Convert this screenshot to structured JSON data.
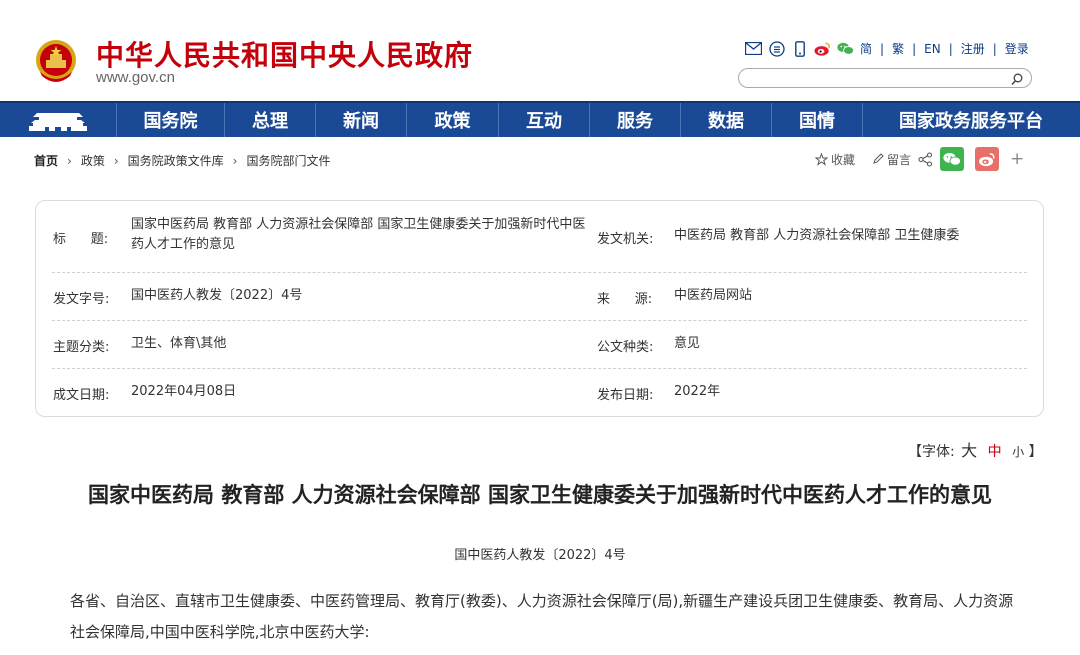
{
  "header": {
    "site_title": "中华人民共和国中央人民政府",
    "site_url": "www.gov.cn",
    "links": [
      "简",
      "繁",
      "EN",
      "注册",
      "登录"
    ],
    "search_placeholder": ""
  },
  "nav": {
    "items": [
      "国务院",
      "总理",
      "新闻",
      "政策",
      "互动",
      "服务",
      "数据",
      "国情",
      "国家政务服务平台"
    ]
  },
  "breadcrumb": {
    "items": [
      "首页",
      "政策",
      "国务院政策文件库",
      "国务院部门文件"
    ]
  },
  "tools": {
    "favorite": "收藏",
    "comment": "留言",
    "plus": "+"
  },
  "info": {
    "rows": [
      {
        "label": "标      题:",
        "value": "国家中医药局 教育部 人力资源社会保障部 国家卫生健康委关于加强新时代中医药人才工作的意见",
        "label2": "发文机关:",
        "value2": "中医药局 教育部 人力资源社会保障部 卫生健康委"
      },
      {
        "label": "发文字号:",
        "value": "国中医药人教发〔2022〕4号",
        "label2": "来      源:",
        "value2": "中医药局网站"
      },
      {
        "label": "主题分类:",
        "value": "卫生、体育\\其他",
        "label2": "公文种类:",
        "value2": "意见"
      },
      {
        "label": "成文日期:",
        "value": "2022年04月08日",
        "label2": "发布日期:",
        "value2": "2022年"
      }
    ]
  },
  "fontctl": {
    "prefix": "【字体:",
    "large": "大",
    "medium": "中",
    "small": "小",
    "suffix": "】"
  },
  "article": {
    "title": "国家中医药局 教育部 人力资源社会保障部 国家卫生健康委关于加强新时代中医药人才工作的意见",
    "doc_number": "国中医药人教发〔2022〕4号",
    "body": "各省、自治区、直辖市卫生健康委、中医药管理局、教育厅(教委)、人力资源社会保障厅(局),新疆生产建设兵团卫生健康委、教育局、人力资源社会保障局,中国中医科学院,北京中医药大学:"
  },
  "colors": {
    "brand_red": "#c4000a",
    "nav_blue": "#1a4a95",
    "link_blue": "#0f3d86",
    "wechat_green": "#3fb34f",
    "weibo_red": "#e8706a"
  }
}
